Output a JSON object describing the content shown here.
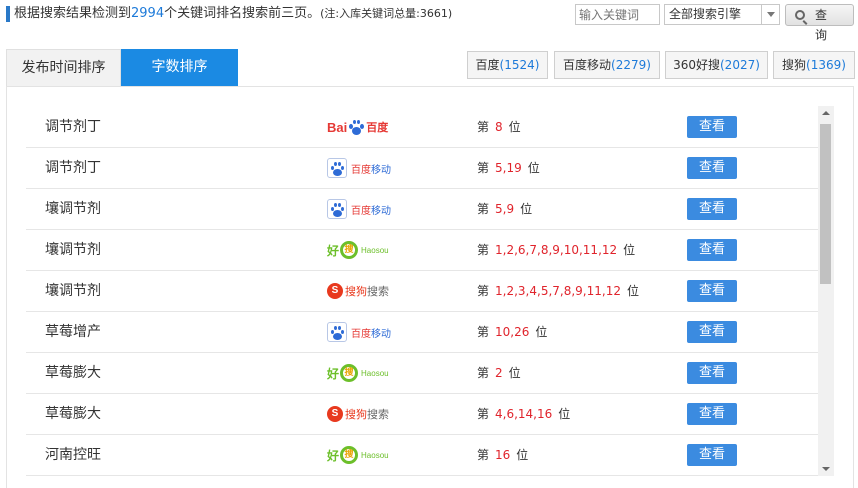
{
  "header": {
    "summary_prefix": "根据搜索结果检测到",
    "keyword_count": "2994",
    "summary_suffix": "个关键词排名搜索前三页。",
    "note": "(注:入库关键词总量:3661)",
    "search_placeholder": "输入关键词",
    "engine_select_value": "全部搜索引擎",
    "search_button": "查 询"
  },
  "tabs": [
    {
      "label": "发布时间排序",
      "active": false
    },
    {
      "label": "字数排序",
      "active": true
    }
  ],
  "engine_tabs": [
    {
      "name": "百度",
      "count": "(1524)"
    },
    {
      "name": "百度移动",
      "count": "(2279)"
    },
    {
      "name": "360好搜",
      "count": "(2027)"
    },
    {
      "name": "搜狗",
      "count": "(1369)"
    }
  ],
  "logo_text": {
    "baidu": {
      "a": "Bai",
      "b": "百度"
    },
    "baidu_mobile": {
      "a": "百度",
      "b": "移动"
    },
    "haosou": {
      "a": "好",
      "b": "搜",
      "en": "Haosou"
    },
    "sogou": {
      "s": "S",
      "a": "搜狗",
      "b": "搜索"
    }
  },
  "rank_prefix": "第",
  "rank_suffix": "位",
  "view_label": "查看",
  "rows": [
    {
      "keyword": "调节剂丁",
      "engine": "baidu",
      "positions": "8"
    },
    {
      "keyword": "调节剂丁",
      "engine": "baidu_mobile",
      "positions": "5,19"
    },
    {
      "keyword": "壤调节剂",
      "engine": "baidu_mobile",
      "positions": "5,9"
    },
    {
      "keyword": "壤调节剂",
      "engine": "haosou",
      "positions": "1,2,6,7,8,9,10,11,12"
    },
    {
      "keyword": "壤调节剂",
      "engine": "sogou",
      "positions": "1,2,3,4,5,7,8,9,11,12"
    },
    {
      "keyword": "草莓增产",
      "engine": "baidu_mobile",
      "positions": "10,26"
    },
    {
      "keyword": "草莓膨大",
      "engine": "haosou",
      "positions": "2"
    },
    {
      "keyword": "草莓膨大",
      "engine": "sogou",
      "positions": "4,6,14,16"
    },
    {
      "keyword": "河南控旺",
      "engine": "haosou",
      "positions": "16"
    }
  ]
}
